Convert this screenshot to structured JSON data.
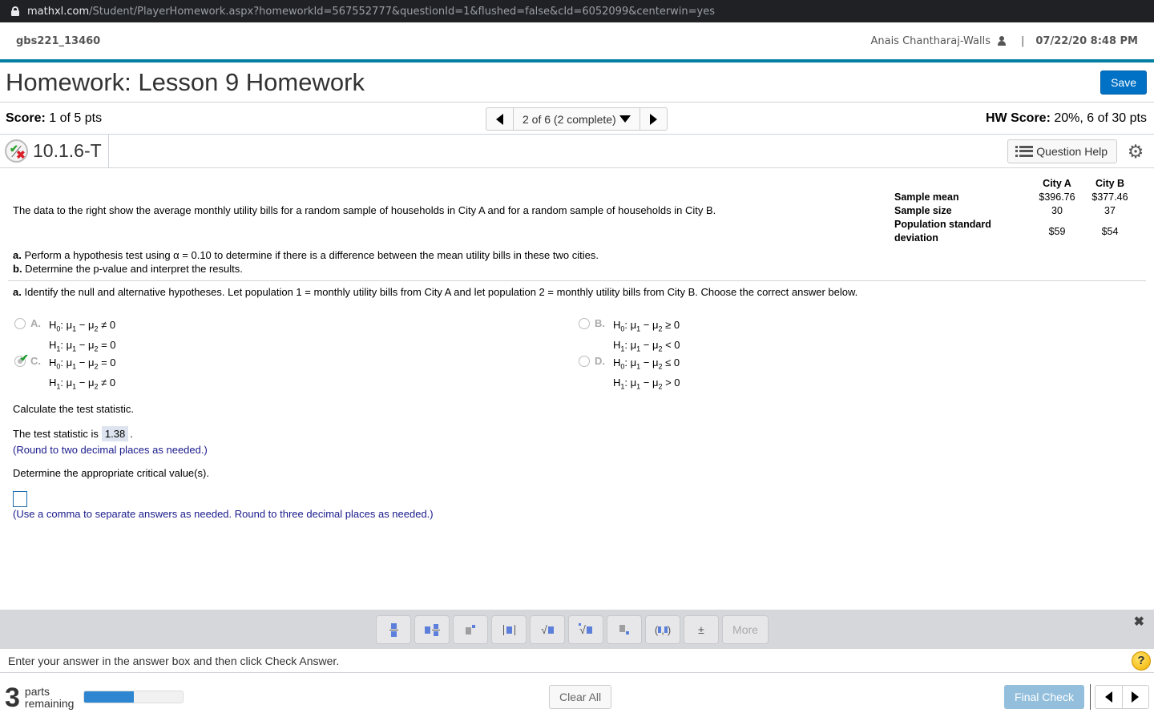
{
  "browser": {
    "url_domain": "mathxl.com",
    "url_path": "/Student/PlayerHomework.aspx?homeworkId=567552777&questionId=1&flushed=false&cId=6052099&centerwin=yes"
  },
  "topbar": {
    "course": "gbs221_13460",
    "user": "Anais Chantharaj-Walls",
    "separator": "|",
    "datetime": "07/22/20 8:48 PM"
  },
  "title": {
    "text": "Homework: Lesson 9 Homework",
    "save_label": "Save"
  },
  "score": {
    "label": "Score:",
    "value": "1 of 5 pts",
    "question_nav": "2 of 6 (2 complete)",
    "hw_label": "HW Score:",
    "hw_value": "20%, 6 of 30 pts"
  },
  "question": {
    "id": "10.1.6-T",
    "help_label": "Question Help"
  },
  "problem": {
    "intro": "The data to the right show the average monthly utility bills for a random sample of households in City A and for a random sample of households in City B.",
    "table": {
      "headers": [
        "",
        "City A",
        "City B"
      ],
      "rows": [
        {
          "label": "Sample mean",
          "a": "$396.76",
          "b": "$377.46"
        },
        {
          "label": "Sample size",
          "a": "30",
          "b": "37"
        },
        {
          "label": "Population standard deviation",
          "a": "$59",
          "b": "$54"
        }
      ]
    },
    "part_a_prefix": "a.",
    "part_a": " Perform a hypothesis test using α = 0.10 to determine if there is a difference between the mean utility bills in these two cities.",
    "part_b_prefix": "b.",
    "part_b": " Determine the p-value and interpret the results.",
    "prompt_prefix": "a.",
    "prompt": " Identify the null and alternative hypotheses. Let population 1 = monthly utility bills from City A and let population 2 = monthly utility bills from City B. Choose the correct answer below.",
    "choices": [
      {
        "letter": "A.",
        "h0_op": "≠",
        "h1_op": "=",
        "selected": false
      },
      {
        "letter": "B.",
        "h0_op": "≥",
        "h1_op": "<",
        "selected": false
      },
      {
        "letter": "C.",
        "h0_op": "=",
        "h1_op": "≠",
        "selected": true,
        "correct": true
      },
      {
        "letter": "D.",
        "h0_op": "≤",
        "h1_op": ">",
        "selected": false
      }
    ],
    "calc_label": "Calculate the test statistic.",
    "ts_prefix": "The test statistic is",
    "ts_value": "1.38",
    "ts_suffix": ".",
    "ts_hint": "(Round to two decimal places as needed.)",
    "crit_label": "Determine the appropriate critical value(s).",
    "crit_value": "",
    "crit_hint": "(Use a comma to separate answers as needed. Round to three decimal places as needed.)"
  },
  "palette": {
    "buttons": [
      "fraction",
      "mixed-number",
      "exponent",
      "absolute-value",
      "square-root",
      "nth-root",
      "subscript",
      "ordered-pair",
      "plus-minus"
    ],
    "plusminus": "±",
    "more_label": "More",
    "close": "✖"
  },
  "footer": {
    "instruction": "Enter your answer in the answer box and then click Check Answer.",
    "parts_count": "3",
    "parts_word": "parts",
    "remaining_word": "remaining",
    "progress_fraction": 0.5,
    "clear_label": "Clear All",
    "final_label": "Final Check"
  }
}
